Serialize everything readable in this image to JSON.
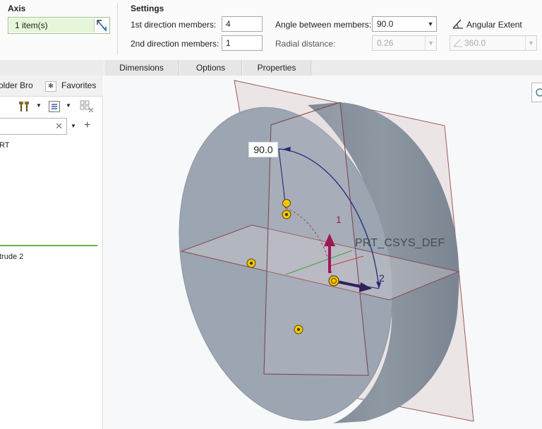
{
  "axis": {
    "title": "Axis",
    "collector_value": "1 item(s)"
  },
  "settings": {
    "title": "Settings",
    "first_direction_label": "1st direction members:",
    "first_direction_value": "4",
    "second_direction_label": "2nd direction members:",
    "second_direction_value": "1",
    "angle_label": "Angle between members:",
    "angle_value": "90.0",
    "radial_label": "Radial distance:",
    "radial_value": "0.26",
    "angular_extent_label": "Angular Extent",
    "angular_extent_value": "360.0"
  },
  "tabs": [
    "Dimensions",
    "Options",
    "Properties"
  ],
  "navigator": {
    "folder_tab": "older Bro",
    "favorites_tab": "Favorites",
    "tree_items": [
      "RT",
      "trude 2"
    ]
  },
  "viewport": {
    "dimension_value": "90.0",
    "csys_label": "PRT_CSYS_DEF",
    "axis_labels": [
      "1",
      "2"
    ]
  },
  "colors": {
    "accent_green": "#63b33f",
    "collector_bg": "#e5f6d9",
    "part_gray": "#9aa5b1",
    "csys_magenta": "#a01658",
    "csys_navy": "#30205e",
    "dimension_navy": "#222a7a"
  }
}
